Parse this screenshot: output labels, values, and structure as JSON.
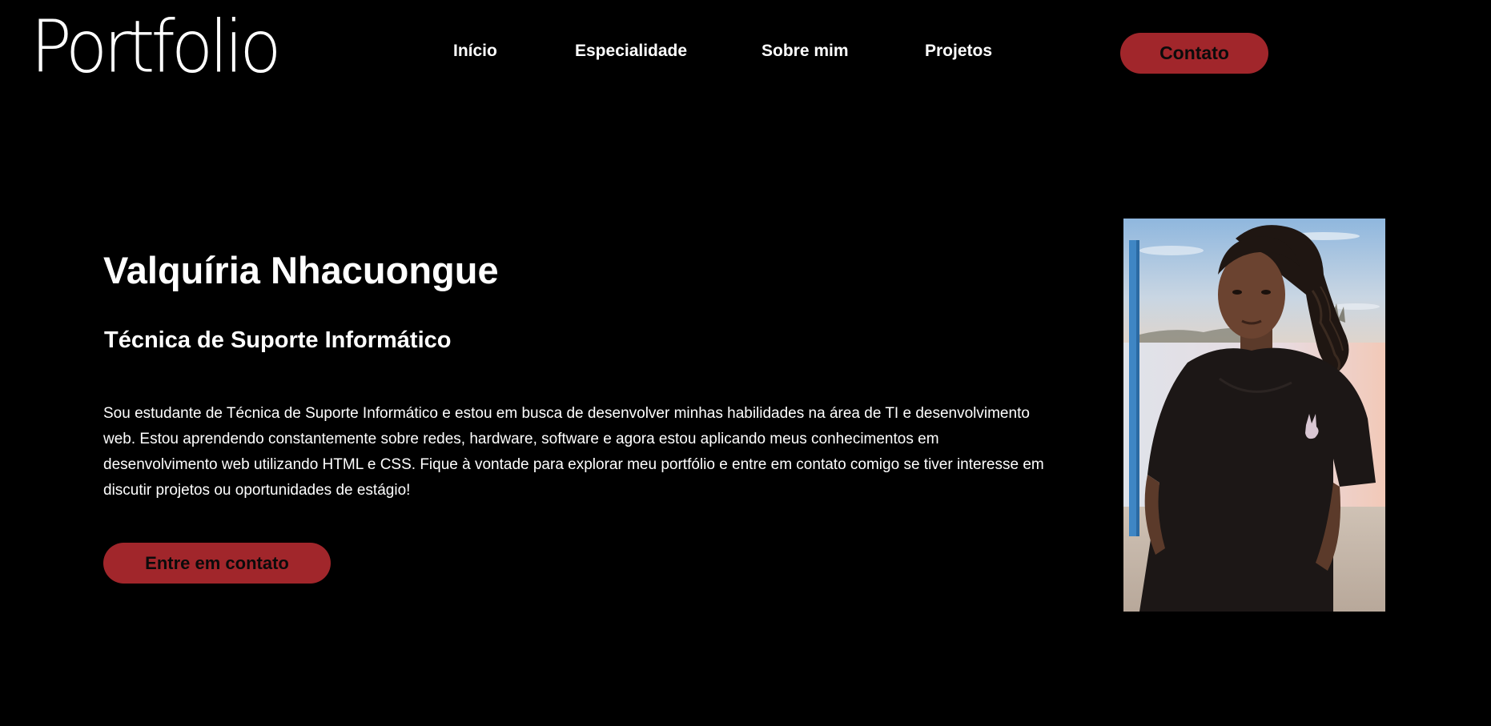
{
  "header": {
    "logo_text": "Portfolio",
    "nav": [
      {
        "label": "Início"
      },
      {
        "label": "Especialidade"
      },
      {
        "label": "Sobre mim"
      },
      {
        "label": "Projetos"
      }
    ],
    "contact_button": "Contato"
  },
  "hero": {
    "name": "Valquíria Nhacuongue",
    "role": "Técnica de Suporte Informático",
    "description": "Sou estudante de Técnica de Suporte Informático e estou em busca de desenvolver minhas habilidades na área de TI e desenvolvimento web. Estou aprendendo constantemente sobre redes, hardware, software e agora estou aplicando meus conhecimentos em desenvolvimento web utilizando HTML e CSS. Fique à vontade para explorar meu portfólio e entre em contato comigo se tiver interesse em discutir projetos ou oportunidades de estágio!",
    "cta_button": "Entre em contato"
  },
  "colors": {
    "background": "#000000",
    "text": "#ffffff",
    "accent": "#a1262b",
    "button_text": "#0b0b0b"
  }
}
